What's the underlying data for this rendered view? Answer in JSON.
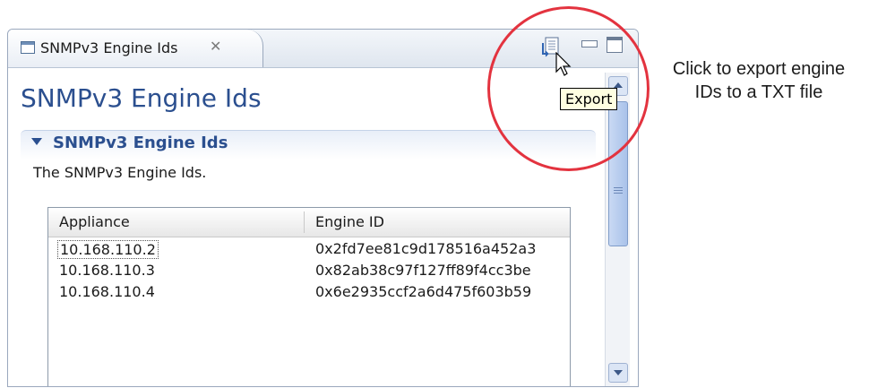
{
  "view": {
    "tab_label": "SNMPv3 Engine Ids",
    "tab_close_icon": "close-icon",
    "toolbar": {
      "export_icon": "export-icon",
      "minimize_icon": "minimize-icon",
      "maximize_icon": "maximize-icon",
      "tooltip": "Export"
    }
  },
  "form": {
    "title": "SNMPv3 Engine Ids",
    "section": {
      "title": "SNMPv3 Engine Ids",
      "description": "The SNMPv3 Engine Ids."
    }
  },
  "table": {
    "columns": [
      "Appliance",
      "Engine ID"
    ],
    "rows": [
      {
        "appliance": "10.168.110.2",
        "engine_id": "0x2fd7ee81c9d178516a452a3"
      },
      {
        "appliance": "10.168.110.3",
        "engine_id": "0x82ab38c97f127ff89f4cc3be"
      },
      {
        "appliance": "10.168.110.4",
        "engine_id": "0x6e2935ccf2a6d475f603b59"
      }
    ]
  },
  "annotation": {
    "line1": "Click to export engine",
    "line2": "IDs to a TXT  file"
  },
  "colors": {
    "title_blue": "#2b4f8f",
    "highlight_red": "#e3333f",
    "tooltip_bg": "#ffffe1"
  }
}
